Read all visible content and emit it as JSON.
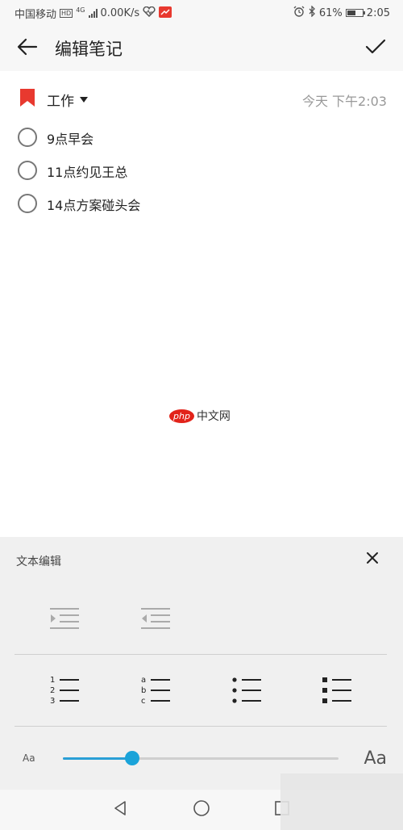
{
  "status_bar": {
    "carrier": "中国移动",
    "hd_badge": "HD",
    "network": "4G",
    "speed": "0.00K/s",
    "battery_percent": "61%",
    "battery_level": 0.61,
    "time": "2:05"
  },
  "app_bar": {
    "title": "编辑笔记"
  },
  "note": {
    "category": "工作",
    "timestamp": "今天 下午2:03",
    "todos": [
      {
        "text": "9点早会",
        "checked": false
      },
      {
        "text": "11点约见王总",
        "checked": false
      },
      {
        "text": "14点方案碰头会",
        "checked": false
      }
    ],
    "watermark": {
      "brand": "php",
      "site": "中文网"
    }
  },
  "edit_panel": {
    "title": "文本编辑",
    "font_size": {
      "small_label": "Aa",
      "large_label": "Aa",
      "level": 0.25
    }
  },
  "icons": {
    "back": "arrow-left-icon",
    "confirm": "check-icon",
    "bookmark": "bookmark-icon",
    "close": "close-icon",
    "indent": "indent-icon",
    "outdent": "outdent-icon",
    "numbered": "numbered-list-icon",
    "alpha": "alpha-list-icon",
    "bullet": "bullet-list-icon",
    "square_bullet": "square-bullet-list-icon"
  },
  "colors": {
    "accent": "#1aa3d9",
    "bookmark": "#e8392f",
    "panel_bg": "#f0f0f0"
  }
}
